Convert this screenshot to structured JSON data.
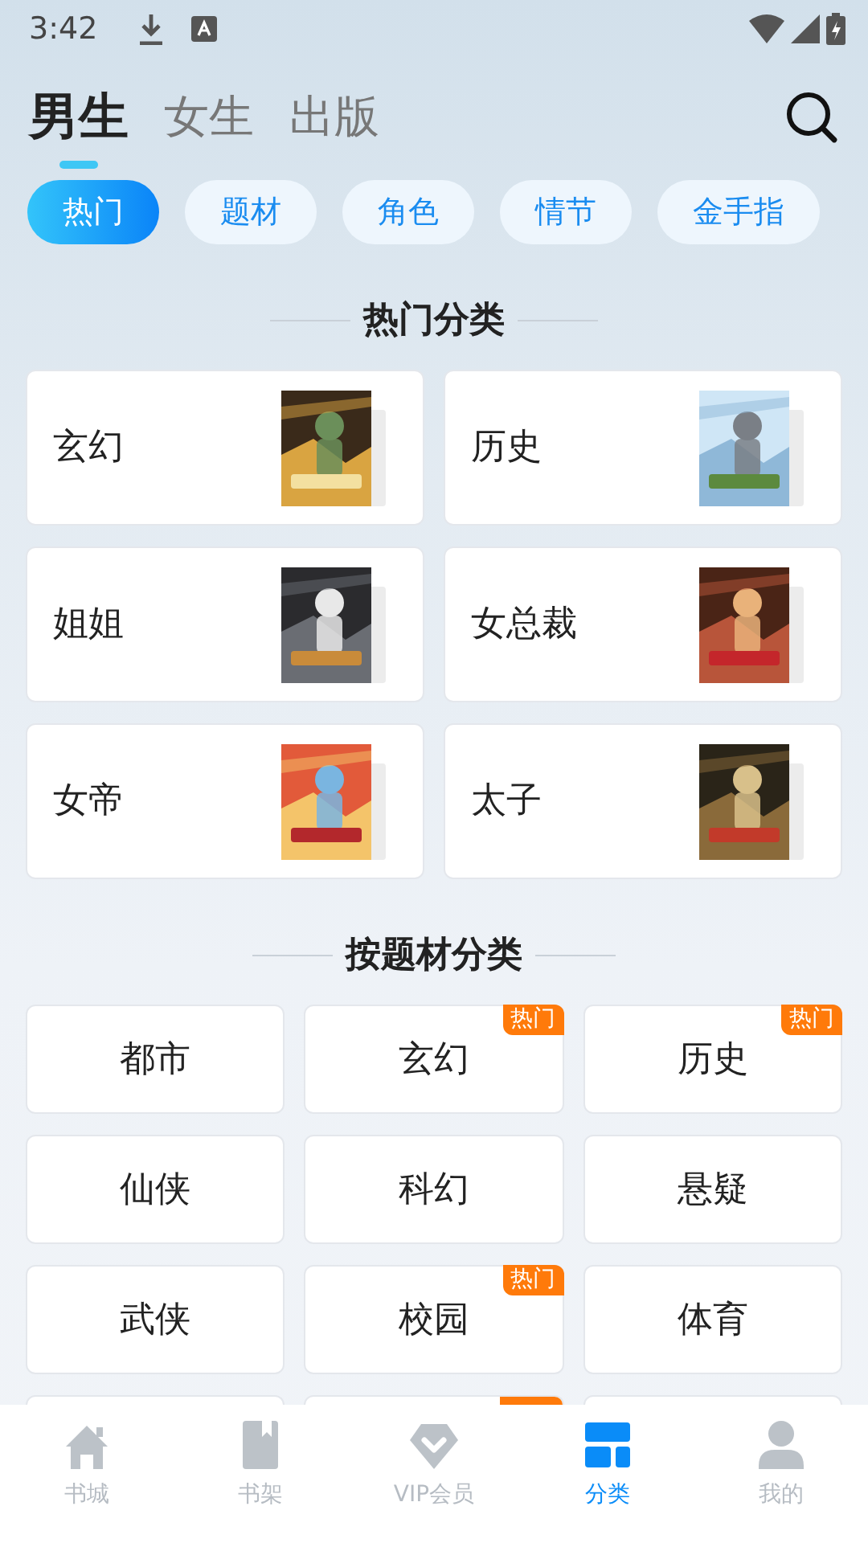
{
  "status_bar": {
    "time": "3:42"
  },
  "tabs": [
    {
      "label": "男生",
      "selected": true
    },
    {
      "label": "女生",
      "selected": false
    },
    {
      "label": "出版",
      "selected": false
    }
  ],
  "chips": [
    {
      "label": "热门",
      "selected": true
    },
    {
      "label": "题材",
      "selected": false
    },
    {
      "label": "角色",
      "selected": false
    },
    {
      "label": "情节",
      "selected": false
    },
    {
      "label": "金手指",
      "selected": false
    }
  ],
  "hot_section": {
    "title": "热门分类",
    "items": [
      {
        "label": "玄幻"
      },
      {
        "label": "历史"
      },
      {
        "label": "姐姐"
      },
      {
        "label": "女总裁"
      },
      {
        "label": "女帝"
      },
      {
        "label": "太子"
      }
    ]
  },
  "genre_section": {
    "title": "按题材分类",
    "items": [
      {
        "label": "都市",
        "hot": false
      },
      {
        "label": "玄幻",
        "hot": true,
        "badge": "热门"
      },
      {
        "label": "历史",
        "hot": true,
        "badge": "热门"
      },
      {
        "label": "仙侠",
        "hot": false
      },
      {
        "label": "科幻",
        "hot": false
      },
      {
        "label": "悬疑",
        "hot": false
      },
      {
        "label": "武侠",
        "hot": false
      },
      {
        "label": "校园",
        "hot": true,
        "badge": "热门"
      },
      {
        "label": "体育",
        "hot": false
      },
      {
        "hot": false
      },
      {
        "hot": true
      },
      {
        "hot": false
      }
    ]
  },
  "bottom_nav": [
    {
      "label": "书城",
      "kind": "home",
      "selected": false
    },
    {
      "label": "书架",
      "kind": "shelf",
      "selected": false
    },
    {
      "label": "VIP会员",
      "kind": "vip",
      "selected": false
    },
    {
      "label": "分类",
      "kind": "category",
      "selected": true
    },
    {
      "label": "我的",
      "kind": "profile",
      "selected": false
    }
  ]
}
